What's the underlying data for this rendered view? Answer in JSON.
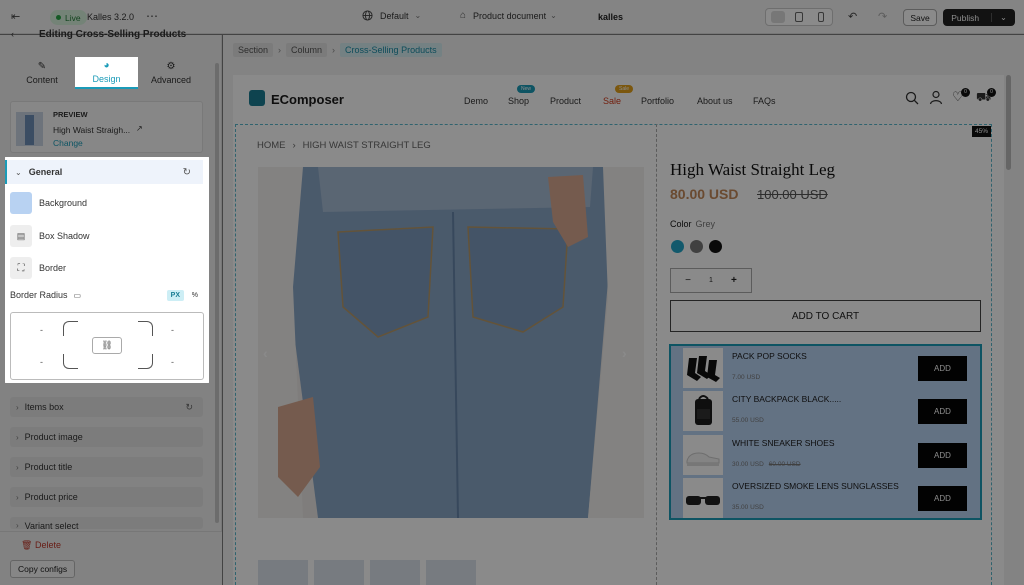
{
  "topbar": {
    "live_label": "Live",
    "theme_name": "Kalles 3.2.0",
    "more_icon": "⋯",
    "device_label": "Default",
    "template_label": "Product document",
    "store_label": "kalles",
    "save_label": "Save",
    "publish_label": "Publish"
  },
  "panel": {
    "header_title": "Editing Cross-Selling Products",
    "tabs": [
      {
        "label": "Content",
        "icon": "pencil-icon"
      },
      {
        "label": "Design",
        "icon": "palette-icon"
      },
      {
        "label": "Advanced",
        "icon": "gear-icon"
      }
    ],
    "preview": {
      "label": "PREVIEW",
      "product": "High Waist Straigh...",
      "change_label": "Change"
    },
    "general": {
      "title": "General",
      "background_label": "Background",
      "box_shadow_label": "Box Shadow",
      "border_label": "Border",
      "border_radius_label": "Border Radius",
      "unit_px": "PX",
      "unit_pct": "%",
      "radius_values": [
        "-",
        "-",
        "-",
        "-"
      ]
    },
    "sections": [
      "Items box",
      "Product image",
      "Product title",
      "Product price",
      "Variant select"
    ],
    "delete_label": "Delete",
    "copy_label": "Copy configs"
  },
  "breadcrumb": [
    "Section",
    "Column",
    "Cross-Selling Products"
  ],
  "site": {
    "logo": "EComposer",
    "nav": [
      "Demo",
      "Shop",
      "Product",
      "Sale",
      "Portfolio",
      "About us",
      "FAQs"
    ],
    "nav_badges": {
      "shop": "New",
      "sale": "Sale"
    },
    "wishlist_count": "0",
    "cart_count": "0"
  },
  "product": {
    "breadcrumb_home": "HOME",
    "breadcrumb_current": "HIGH WAIST STRAIGHT LEG",
    "discount_badge": "45%",
    "title": "High Waist Straight Leg",
    "price": "80.00 USD",
    "compare_price": "100.00 USD",
    "color_label": "Color",
    "color_value": "Grey",
    "swatches": [
      "#22a5c7",
      "#777777",
      "#111111"
    ],
    "qty_minus": "−",
    "qty_value": "1",
    "qty_plus": "+",
    "add_to_cart_label": "ADD TO CART"
  },
  "cross_sell": [
    {
      "name": "PACK POP SOCKS",
      "price": "7.00 USD",
      "old": "",
      "button": "ADD"
    },
    {
      "name": "CITY BACKPACK BLACK.....",
      "price": "55.00 USD",
      "old": "",
      "button": "ADD"
    },
    {
      "name": "WHITE SNEAKER SHOES",
      "price": "30.00 USD",
      "old": "60.00 USD",
      "button": "ADD"
    },
    {
      "name": "OVERSIZED SMOKE LENS SUNGLASSES",
      "price": "35.00 USD",
      "old": "",
      "button": "ADD"
    }
  ]
}
